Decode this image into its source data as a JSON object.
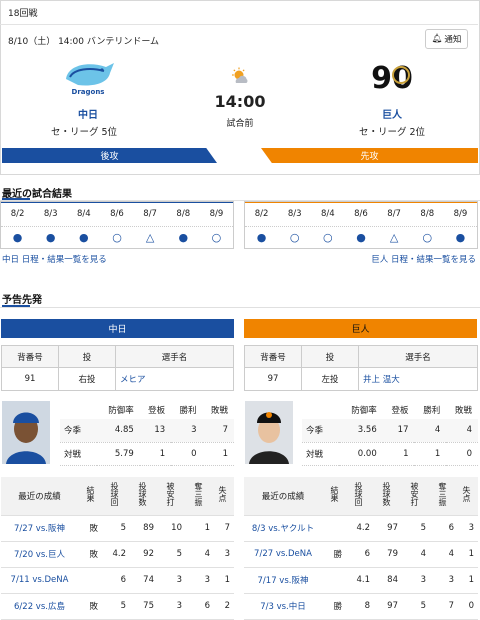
{
  "game": {
    "round": "18回戦",
    "info": "8/10（土） 14:00 バンテリンドーム",
    "notify": "通知",
    "time": "14:00",
    "status": "試合前"
  },
  "home": {
    "name": "中日",
    "rank": "セ・リーグ 5位",
    "order": "後攻",
    "color": "#1a4fa0",
    "logo_text": "Dragons"
  },
  "away": {
    "name": "巨人",
    "rank": "セ・リーグ 2位",
    "order": "先攻",
    "color": "#f08400",
    "logo_text": "90"
  },
  "recent": {
    "title": "最近の試合結果",
    "home": {
      "dates": [
        "8/2",
        "8/3",
        "8/4",
        "8/6",
        "8/7",
        "8/8",
        "8/9"
      ],
      "marks": [
        "●",
        "●",
        "●",
        "○",
        "△",
        "●",
        "○"
      ],
      "link": "中日 日程・結果一覧を見る"
    },
    "away": {
      "dates": [
        "8/2",
        "8/3",
        "8/4",
        "8/6",
        "8/7",
        "8/8",
        "8/9"
      ],
      "marks": [
        "●",
        "○",
        "○",
        "●",
        "△",
        "○",
        "●"
      ],
      "link": "巨人 日程・結果一覧を見る"
    }
  },
  "pitchers": {
    "title": "予告先発",
    "headers": {
      "number": "背番号",
      "throw": "投",
      "name": "選手名"
    },
    "stat_headers": [
      "防御率",
      "登板",
      "勝利",
      "敗戦"
    ],
    "games_headers": [
      "最近の成績",
      "結果",
      "投球回",
      "投球数",
      "被安打",
      "奪三振",
      "失点"
    ],
    "home": {
      "team": "中日",
      "number": "91",
      "throw": "右投",
      "name": "メヒア",
      "stats": [
        {
          "label": "今季",
          "era": "4.85",
          "g": "13",
          "w": "3",
          "l": "7"
        },
        {
          "label": "対戦",
          "era": "5.79",
          "g": "1",
          "w": "0",
          "l": "1"
        }
      ],
      "games": [
        {
          "game": "7/27 vs.阪神",
          "res": "敗",
          "ip": "5",
          "np": "89",
          "h": "10",
          "k": "1",
          "r": "7"
        },
        {
          "game": "7/20 vs.巨人",
          "res": "敗",
          "ip": "4.2",
          "np": "92",
          "h": "5",
          "k": "4",
          "r": "3"
        },
        {
          "game": "7/11 vs.DeNA",
          "res": "",
          "ip": "6",
          "np": "74",
          "h": "3",
          "k": "3",
          "r": "1"
        },
        {
          "game": "6/22 vs.広島",
          "res": "敗",
          "ip": "5",
          "np": "75",
          "h": "3",
          "k": "6",
          "r": "2"
        }
      ]
    },
    "away": {
      "team": "巨人",
      "number": "97",
      "throw": "左投",
      "name": "井上 温大",
      "stats": [
        {
          "label": "今季",
          "era": "3.56",
          "g": "17",
          "w": "4",
          "l": "4"
        },
        {
          "label": "対戦",
          "era": "0.00",
          "g": "1",
          "w": "1",
          "l": "0"
        }
      ],
      "games": [
        {
          "game": "8/3 vs.ヤクルト",
          "res": "",
          "ip": "4.2",
          "np": "97",
          "h": "5",
          "k": "6",
          "r": "3"
        },
        {
          "game": "7/27 vs.DeNA",
          "res": "勝",
          "ip": "6",
          "np": "79",
          "h": "4",
          "k": "4",
          "r": "1"
        },
        {
          "game": "7/17 vs.阪神",
          "res": "",
          "ip": "4.1",
          "np": "84",
          "h": "3",
          "k": "3",
          "r": "1"
        },
        {
          "game": "7/3 vs.中日",
          "res": "勝",
          "ip": "8",
          "np": "97",
          "h": "5",
          "k": "7",
          "r": "0"
        }
      ]
    }
  }
}
